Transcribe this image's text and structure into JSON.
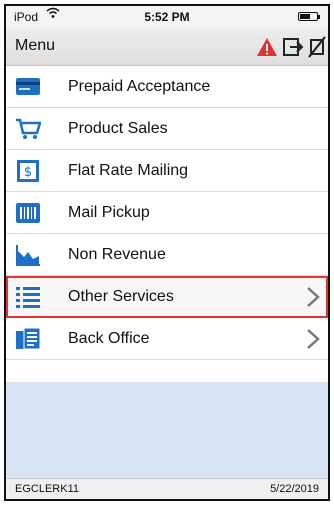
{
  "status_bar": {
    "carrier": "iPod",
    "wifi_icon": "wifi-icon",
    "time": "5:52 PM",
    "battery_icon": "battery-icon"
  },
  "header": {
    "title": "Menu",
    "icons": [
      "warning-icon",
      "logout-icon",
      "no-printer-icon"
    ],
    "warning_color": "#e0342f"
  },
  "menu": {
    "items": [
      {
        "label": "Prepaid Acceptance",
        "icon": "prepaid-card-icon",
        "chevron": false
      },
      {
        "label": "Product Sales",
        "icon": "shopping-cart-icon",
        "chevron": false
      },
      {
        "label": "Flat Rate Mailing",
        "icon": "stamp-icon",
        "chevron": false
      },
      {
        "label": "Mail Pickup",
        "icon": "barcode-icon",
        "chevron": false
      },
      {
        "label": "Non Revenue",
        "icon": "area-chart-icon",
        "chevron": false
      },
      {
        "label": "Other Services",
        "icon": "list-icon",
        "chevron": true,
        "selected": true
      },
      {
        "label": "Back Office",
        "icon": "documents-icon",
        "chevron": true
      }
    ]
  },
  "footer": {
    "user": "EGCLERK11",
    "date": "5/22/2019"
  },
  "colors": {
    "icon_blue": "#1f6fc4",
    "selection_outline": "#e0342f",
    "empty_area": "#d7e5f5"
  }
}
